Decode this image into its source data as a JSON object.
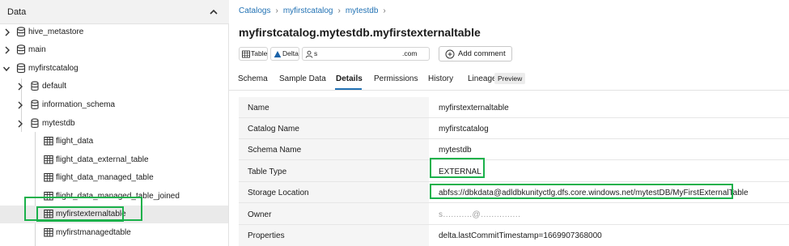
{
  "sidebar": {
    "title": "Data",
    "tree": [
      {
        "label": "hive_metastore",
        "icon": "database-icon",
        "expandable": true
      },
      {
        "label": "main",
        "icon": "database-icon",
        "expandable": true
      },
      {
        "label": "myfirstcatalog",
        "icon": "database-icon",
        "expandable": true
      },
      {
        "label": "default",
        "icon": "schema-icon",
        "expandable": true
      },
      {
        "label": "information_schema",
        "icon": "schema-icon",
        "expandable": true
      },
      {
        "label": "mytestdb",
        "icon": "schema-icon",
        "expandable": true
      },
      {
        "label": "flight_data",
        "icon": "table-icon",
        "expandable": false
      },
      {
        "label": "flight_data_external_table",
        "icon": "table-icon",
        "expandable": false
      },
      {
        "label": "flight_data_managed_table",
        "icon": "table-icon",
        "expandable": false
      },
      {
        "label": "flight_data_managed_table_joined",
        "icon": "table-icon",
        "expandable": false
      },
      {
        "label": "myfirstexternaltable",
        "icon": "table-icon",
        "expandable": false,
        "selected": true
      },
      {
        "label": "myfirstmanagedtable",
        "icon": "table-icon",
        "expandable": false
      }
    ]
  },
  "breadcrumb": [
    "Catalogs",
    "myfirstcatalog",
    "mytestdb"
  ],
  "header": {
    "title": "myfirstcatalog.mytestdb.myfirstexternaltable",
    "chips": {
      "table": "Table",
      "delta": "Delta",
      "owner_prefix": "s",
      "owner_suffix": ".com"
    },
    "add_comment": "Add comment"
  },
  "tabs": [
    {
      "label": "Schema"
    },
    {
      "label": "Sample Data"
    },
    {
      "label": "Details",
      "active": true
    },
    {
      "label": "Permissions"
    },
    {
      "label": "History"
    },
    {
      "label": "Lineage"
    }
  ],
  "lineage_badge": "Preview",
  "details": [
    {
      "label": "Name",
      "value": "myfirstexternaltable"
    },
    {
      "label": "Catalog Name",
      "value": "myfirstcatalog"
    },
    {
      "label": "Schema Name",
      "value": "mytestdb"
    },
    {
      "label": "Table Type",
      "value": "EXTERNAL"
    },
    {
      "label": "Storage Location",
      "value": "abfss://dbkdata@adldbkunityctlg.dfs.core.windows.net/mytestDB/MyFirstExternalTable"
    },
    {
      "label": "Owner",
      "value": "s...........@..............."
    },
    {
      "label": "Properties",
      "value": "delta.lastCommitTimestamp=1669907368000"
    }
  ],
  "colors": {
    "accent": "#2272b4",
    "highlight": "#1bb14b",
    "selected_row": "#eaeaea",
    "header_bg": "#f2f2f2"
  }
}
